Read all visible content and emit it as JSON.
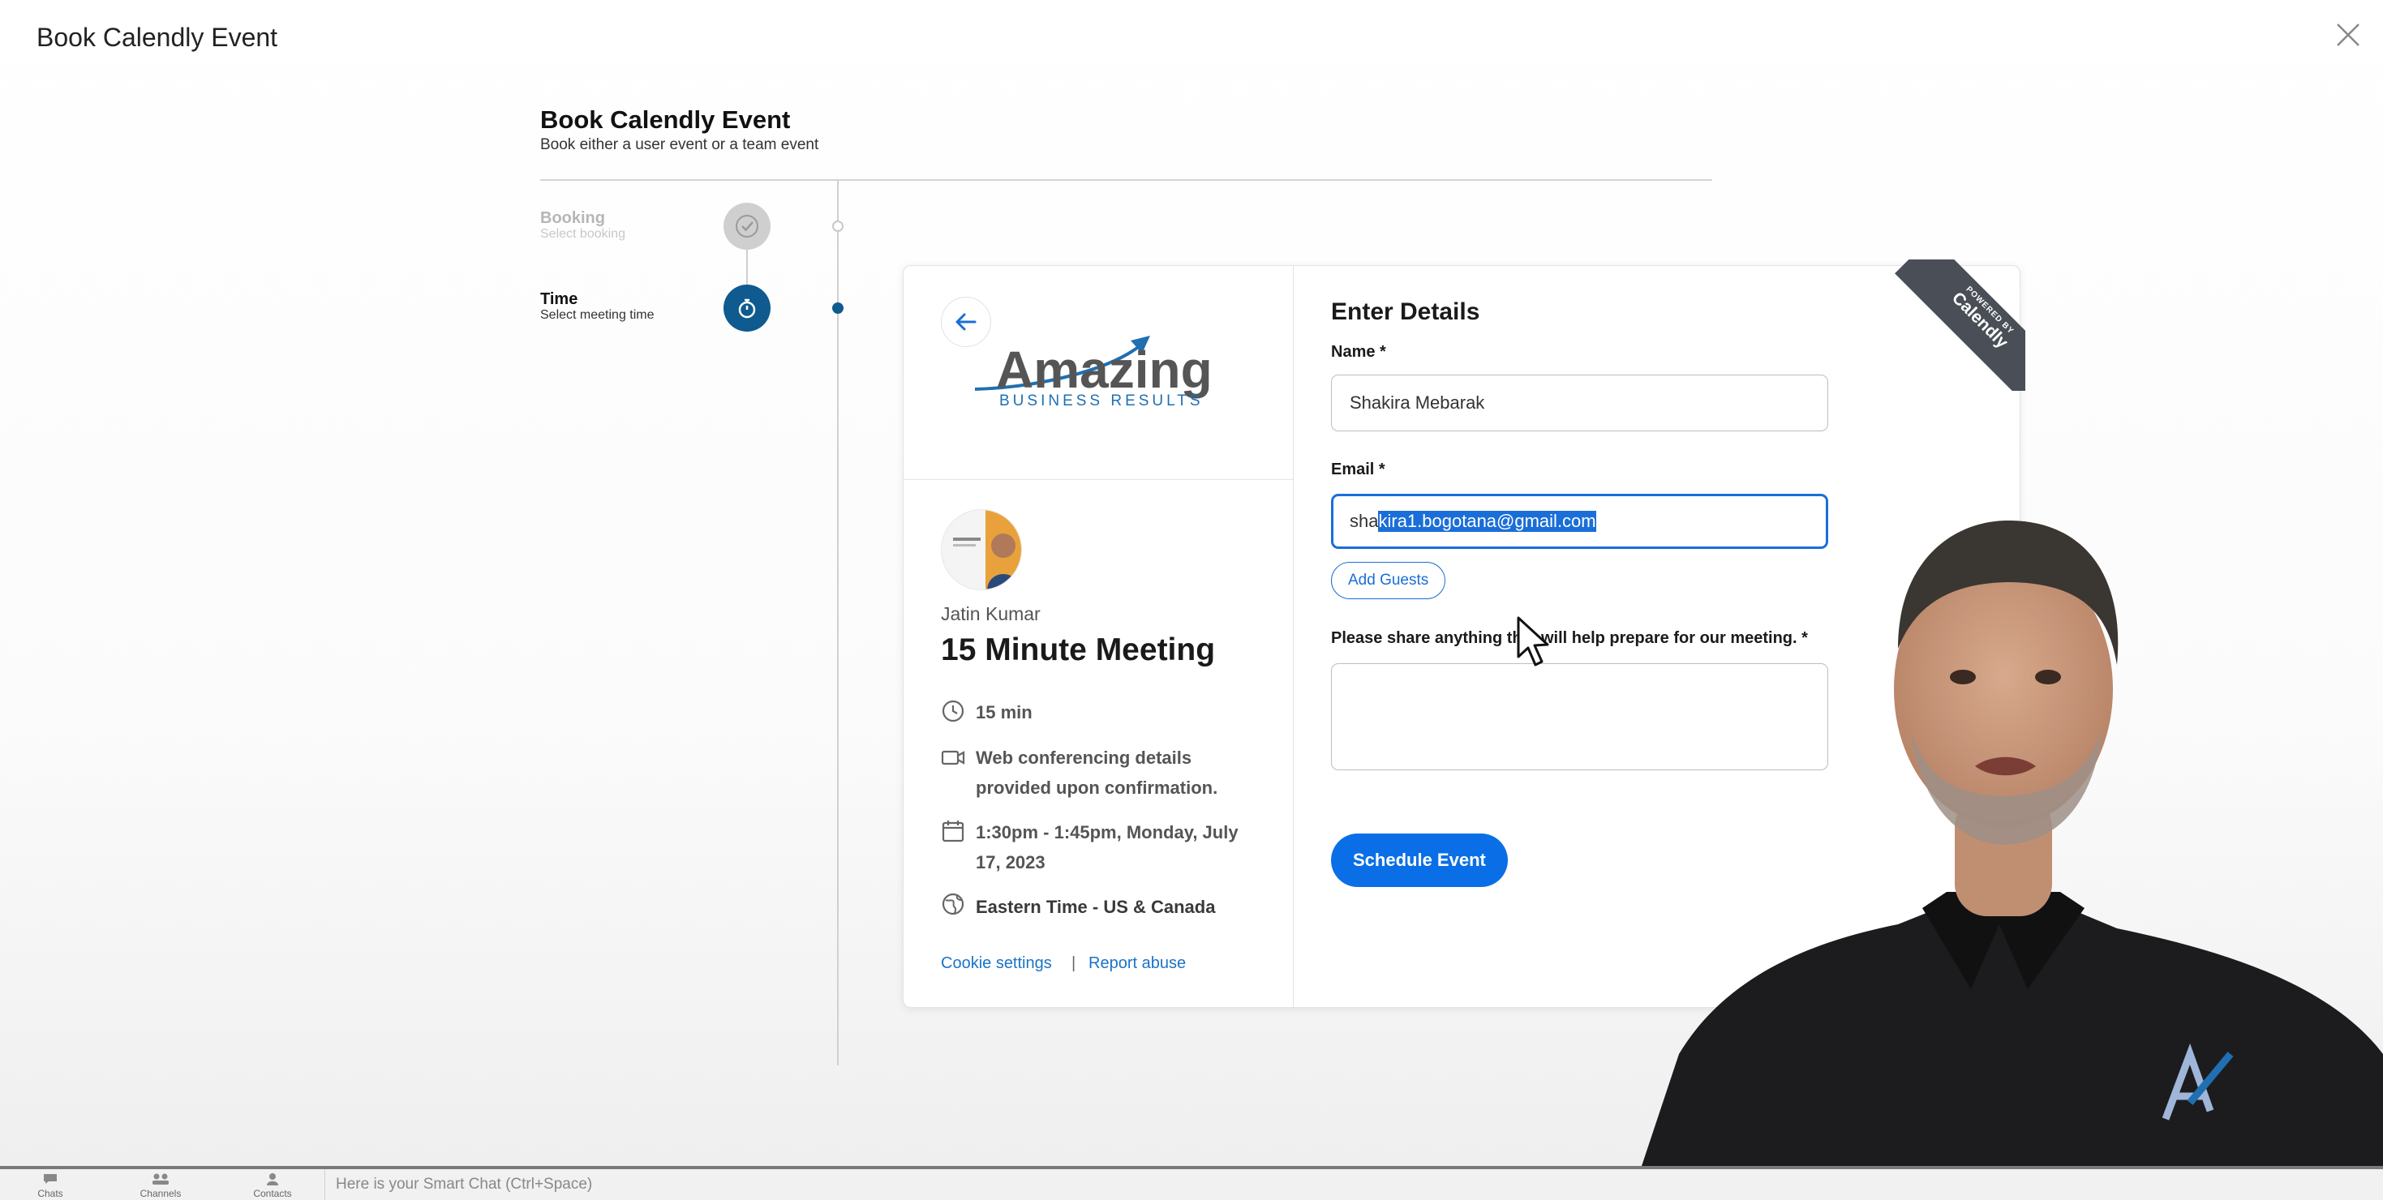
{
  "window": {
    "title": "Book Calendly Event"
  },
  "header": {
    "heading": "Book Calendly Event",
    "subheading": "Book either a user event or a team event"
  },
  "steps": [
    {
      "title": "Booking",
      "subtitle": "Select booking",
      "state": "completed"
    },
    {
      "title": "Time",
      "subtitle": "Select meeting time",
      "state": "active"
    }
  ],
  "event": {
    "logo_text_main": "Amazing",
    "logo_text_sub": "BUSINESS RESULTS",
    "host_name": "Jatin Kumar",
    "title": "15 Minute Meeting",
    "duration": "15 min",
    "conferencing": "Web conferencing details provided upon confirmation.",
    "datetime": "1:30pm - 1:45pm, Monday, July 17, 2023",
    "timezone": "Eastern Time - US & Canada",
    "cookie_link": "Cookie settings",
    "separator": "|",
    "report_link": "Report abuse"
  },
  "form": {
    "heading": "Enter Details",
    "name_label": "Name *",
    "name_value": "Shakira Mebarak",
    "email_label": "Email *",
    "email_value_prefix": "sha",
    "email_value_selected": "kira1.bogotana@gmail.com",
    "add_guests_label": "Add Guests",
    "notes_label": "Please share anything that will help prepare for our meeting. *",
    "notes_value": "",
    "submit_label": "Schedule Event"
  },
  "ribbon": {
    "small": "POWERED BY",
    "brand": "Calendly"
  },
  "bottom_bar": {
    "tabs": [
      "Chats",
      "Channels",
      "Contacts"
    ],
    "smart_chat_placeholder": "Here is your Smart Chat (Ctrl+Space)"
  },
  "colors": {
    "accent": "#0a6fe6",
    "step_active": "#0f5a8f",
    "ribbon": "#4a4f57"
  },
  "icons": [
    "close-icon",
    "check-icon",
    "timer-icon",
    "back-arrow-icon",
    "clock-icon",
    "video-icon",
    "calendar-icon",
    "globe-icon",
    "mouse-pointer-icon",
    "chat-icon",
    "channels-icon",
    "contacts-icon"
  ]
}
